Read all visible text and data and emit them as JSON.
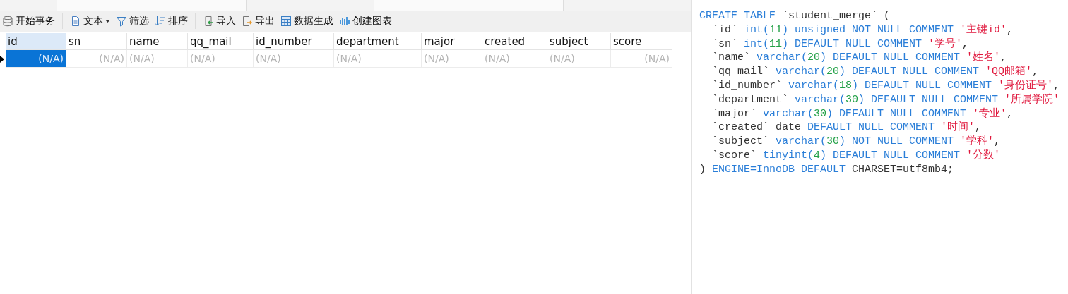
{
  "toolbar": [
    {
      "label": "开始事务"
    },
    {
      "label": "文本"
    },
    {
      "label": "筛选"
    },
    {
      "label": "排序"
    },
    {
      "label": "导入"
    },
    {
      "label": "导出"
    },
    {
      "label": "数据生成"
    },
    {
      "label": "创建图表"
    }
  ],
  "table": {
    "columns": [
      {
        "name": "id",
        "numeric": true,
        "selected": true
      },
      {
        "name": "sn",
        "numeric": true,
        "selected": false
      },
      {
        "name": "name",
        "numeric": false,
        "selected": false
      },
      {
        "name": "qq_mail",
        "numeric": false,
        "selected": false
      },
      {
        "name": "id_number",
        "numeric": false,
        "selected": false
      },
      {
        "name": "department",
        "numeric": false,
        "selected": false
      },
      {
        "name": "major",
        "numeric": false,
        "selected": false
      },
      {
        "name": "created",
        "numeric": false,
        "selected": false
      },
      {
        "name": "subject",
        "numeric": false,
        "selected": false
      },
      {
        "name": "score",
        "numeric": true,
        "selected": false
      }
    ],
    "rows": [
      {
        "current": true,
        "cells": [
          {
            "text": "(N/A)",
            "selected": true
          },
          {
            "text": "(N/A)",
            "selected": false
          },
          {
            "text": "(N/A)",
            "selected": false
          },
          {
            "text": "(N/A)",
            "selected": false
          },
          {
            "text": "(N/A)",
            "selected": false
          },
          {
            "text": "(N/A)",
            "selected": false
          },
          {
            "text": "(N/A)",
            "selected": false
          },
          {
            "text": "(N/A)",
            "selected": false
          },
          {
            "text": "(N/A)",
            "selected": false
          },
          {
            "text": "(N/A)",
            "selected": false
          }
        ]
      }
    ]
  },
  "ddl": {
    "lines": [
      [
        {
          "kind": "keyword",
          "text": "CREATE TABLE"
        },
        {
          "kind": "plain",
          "text": " `student_merge` ("
        }
      ],
      [
        {
          "kind": "plain",
          "text": "  `id` "
        },
        {
          "kind": "keyword",
          "text": "int("
        },
        {
          "kind": "number",
          "text": "11"
        },
        {
          "kind": "keyword",
          "text": ") unsigned NOT NULL COMMENT "
        },
        {
          "kind": "string",
          "text": "'主键id'"
        },
        {
          "kind": "plain",
          "text": ","
        }
      ],
      [
        {
          "kind": "plain",
          "text": "  `sn` "
        },
        {
          "kind": "keyword",
          "text": "int("
        },
        {
          "kind": "number",
          "text": "11"
        },
        {
          "kind": "keyword",
          "text": ") DEFAULT NULL COMMENT "
        },
        {
          "kind": "string",
          "text": "'学号'"
        },
        {
          "kind": "plain",
          "text": ","
        }
      ],
      [
        {
          "kind": "plain",
          "text": "  `name` "
        },
        {
          "kind": "keyword",
          "text": "varchar("
        },
        {
          "kind": "number",
          "text": "20"
        },
        {
          "kind": "keyword",
          "text": ") DEFAULT NULL COMMENT "
        },
        {
          "kind": "string",
          "text": "'姓名'"
        },
        {
          "kind": "plain",
          "text": ","
        }
      ],
      [
        {
          "kind": "plain",
          "text": "  `qq_mail` "
        },
        {
          "kind": "keyword",
          "text": "varchar("
        },
        {
          "kind": "number",
          "text": "20"
        },
        {
          "kind": "keyword",
          "text": ") DEFAULT NULL COMMENT "
        },
        {
          "kind": "string",
          "text": "'QQ邮箱'"
        },
        {
          "kind": "plain",
          "text": ","
        }
      ],
      [
        {
          "kind": "plain",
          "text": "  `id_number` "
        },
        {
          "kind": "keyword",
          "text": "varchar("
        },
        {
          "kind": "number",
          "text": "18"
        },
        {
          "kind": "keyword",
          "text": ") DEFAULT NULL COMMENT "
        },
        {
          "kind": "string",
          "text": "'身份证号'"
        },
        {
          "kind": "plain",
          "text": ","
        }
      ],
      [
        {
          "kind": "plain",
          "text": "  `department` "
        },
        {
          "kind": "keyword",
          "text": "varchar("
        },
        {
          "kind": "number",
          "text": "30"
        },
        {
          "kind": "keyword",
          "text": ") DEFAULT NULL COMMENT "
        },
        {
          "kind": "string",
          "text": "'所属学院'"
        }
      ],
      [
        {
          "kind": "plain",
          "text": "  `major` "
        },
        {
          "kind": "keyword",
          "text": "varchar("
        },
        {
          "kind": "number",
          "text": "30"
        },
        {
          "kind": "keyword",
          "text": ") DEFAULT NULL COMMENT "
        },
        {
          "kind": "string",
          "text": "'专业'"
        },
        {
          "kind": "plain",
          "text": ","
        }
      ],
      [
        {
          "kind": "plain",
          "text": "  `created` date "
        },
        {
          "kind": "keyword",
          "text": "DEFAULT NULL COMMENT "
        },
        {
          "kind": "string",
          "text": "'时间'"
        },
        {
          "kind": "plain",
          "text": ","
        }
      ],
      [
        {
          "kind": "plain",
          "text": "  `subject` "
        },
        {
          "kind": "keyword",
          "text": "varchar("
        },
        {
          "kind": "number",
          "text": "30"
        },
        {
          "kind": "keyword",
          "text": ") NOT NULL COMMENT "
        },
        {
          "kind": "string",
          "text": "'学科'"
        },
        {
          "kind": "plain",
          "text": ","
        }
      ],
      [
        {
          "kind": "plain",
          "text": "  `score` "
        },
        {
          "kind": "keyword",
          "text": "tinyint("
        },
        {
          "kind": "number",
          "text": "4"
        },
        {
          "kind": "keyword",
          "text": ") DEFAULT NULL COMMENT "
        },
        {
          "kind": "string",
          "text": "'分数'"
        }
      ],
      [
        {
          "kind": "plain",
          "text": ") "
        },
        {
          "kind": "keyword",
          "text": "ENGINE=InnoDB DEFAULT"
        },
        {
          "kind": "plain",
          "text": " CHARSET=utf8mb4;"
        }
      ]
    ]
  }
}
